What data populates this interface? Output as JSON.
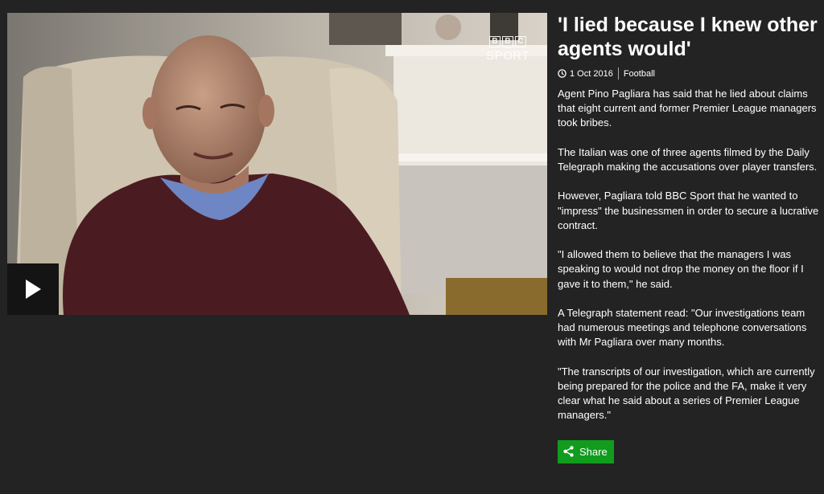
{
  "video": {
    "logo_letters": [
      "B",
      "B",
      "C"
    ],
    "logo_subtitle": "SPORT",
    "play_icon": "play-icon"
  },
  "article": {
    "headline": "'I lied because I knew other agents would'",
    "date": "1 Oct 2016",
    "category": "Football",
    "paragraphs": [
      "Agent Pino Pagliara has said that he lied about claims that eight current and former Premier League managers took bribes.",
      "The Italian was one of three agents filmed by the Daily Telegraph making the accusations over player transfers.",
      "However, Pagliara told BBC Sport that he wanted to \"impress\" the businessmen in order to secure a lucrative contract.",
      "\"I allowed them to believe that the managers I was speaking to would not drop the money on the floor if I gave it to them,\" he said.",
      "A Telegraph statement read: \"Our investigations team had numerous meetings and telephone conversations with Mr Pagliara over many months.",
      "\"The transcripts of our investigation, which are currently being prepared for the police and the FA, make it very clear what he said about a series of Premier League managers.\""
    ],
    "share_label": "Share"
  },
  "colors": {
    "background": "#232323",
    "share_green": "#119c1e",
    "play_bg": "#141414"
  }
}
